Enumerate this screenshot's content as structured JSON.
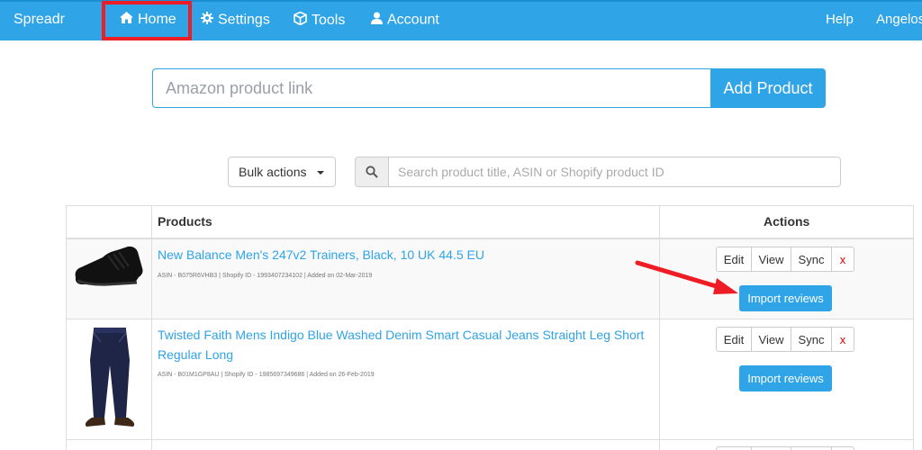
{
  "nav": {
    "brand": "Spreadr",
    "items": [
      {
        "label": "Home",
        "icon": "home-icon"
      },
      {
        "label": "Settings",
        "icon": "gear-icon"
      },
      {
        "label": "Tools",
        "icon": "cube-icon"
      },
      {
        "label": "Account",
        "icon": "user-icon"
      }
    ],
    "help": "Help",
    "user": "Angelos"
  },
  "add_product": {
    "placeholder": "Amazon product link",
    "button": "Add Product"
  },
  "toolbar": {
    "bulk_actions": "Bulk actions",
    "search_placeholder": "Search product title, ASIN or Shopify product ID"
  },
  "table": {
    "headers": {
      "products": "Products",
      "actions": "Actions"
    },
    "rows": [
      {
        "title": "New Balance Men's 247v2 Trainers, Black, 10 UK 44.5 EU",
        "meta": "ASIN - B075R6VHB3  |  Shopify ID - 1993407234102  |  Added on 02-Mar-2019",
        "image": "black-sneaker"
      },
      {
        "title_line1": "Twisted Faith Mens Indigo Blue Washed Denim Smart Casual Jeans Straight Leg Short",
        "title_line2": "Regular Long",
        "meta": "ASIN - B01M1GP8AU  |  Shopify ID - 1985697349686  |  Added on 26-Feb-2019",
        "image": "denim-jeans"
      }
    ],
    "actions": {
      "edit": "Edit",
      "view": "View",
      "sync": "Sync",
      "delete": "x",
      "import": "Import reviews"
    }
  },
  "colors": {
    "accent": "#2fa4e7",
    "highlight": "#ee1c24",
    "annotation_arrow": "#ee1c24"
  }
}
